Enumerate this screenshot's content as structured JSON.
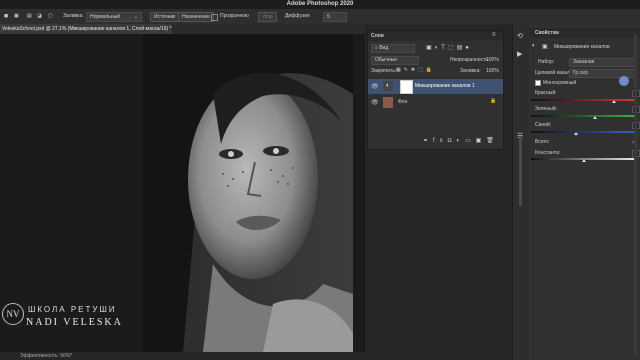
{
  "app": {
    "title": "Adobe Photoshop 2020"
  },
  "options_bar": {
    "fill_label": "Заливка:",
    "fill_mode": "Нормальный",
    "source_button": "Источник",
    "destination_button": "Назначение",
    "transparent_label": "Прозрачною",
    "use_button": "Узор",
    "diffusion_label": "Диффузия",
    "diffusion_value": "5"
  },
  "document": {
    "tab_title": "VeleskaSchool.psd @ 27,1% (Микширование каналов 1, Слой-маска/16) *"
  },
  "status": {
    "efficiency": "Эффективность: 96%*"
  },
  "watermark": {
    "monogram": "NV",
    "line1": "ШКОЛА РЕТУШИ",
    "line2": "NADI VELESKA"
  },
  "layers_panel": {
    "title": "Слои",
    "kind_filter": "Вид",
    "blend_mode": "Обычные",
    "opacity_label": "Непрозрачность:",
    "opacity_value": "100%",
    "lock_label": "Закрепить:",
    "fill_label": "Заливка:",
    "fill_value": "100%",
    "layers": [
      {
        "name": "Микширование каналов 1",
        "selected": true
      },
      {
        "name": "Фон",
        "selected": false
      }
    ]
  },
  "properties_panel": {
    "title": "Свойства",
    "subtitle": "Микширование каналов",
    "preset_label": "Набор:",
    "preset_value": "Заказная",
    "output_label": "Целевой канал:",
    "output_value": "Гр.сер.",
    "monochrome_label": "Монохромный",
    "channels": [
      {
        "label": "Красный:",
        "value": "",
        "color": "#d23a3a",
        "level": 0.78
      },
      {
        "label": "Зеленый:",
        "value": "",
        "color": "#3bb34a",
        "level": 0.6
      },
      {
        "label": "Синий:",
        "value": "",
        "color": "#3a5ed2",
        "level": 0.42
      }
    ],
    "total_label": "Всего:",
    "constant_label": "Константа:",
    "constant_level": 0.5
  },
  "colors": {
    "accent": "#5a8bd6",
    "selected_layer": "#3f5272"
  }
}
